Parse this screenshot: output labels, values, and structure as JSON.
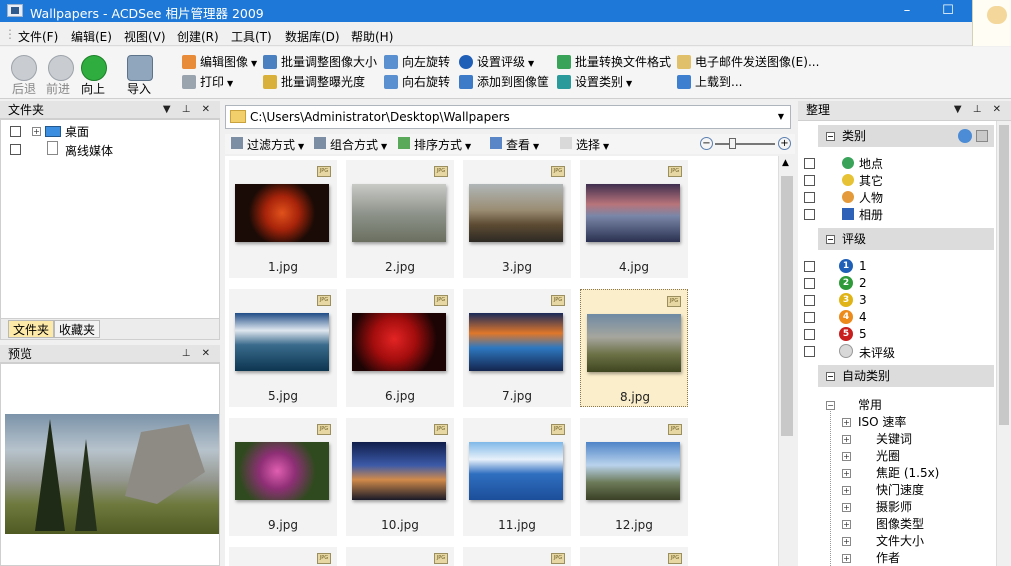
{
  "window": {
    "title": "Wallpapers - ACDSee 相片管理器 2009",
    "minimize": "–",
    "maximize": "☐"
  },
  "menu": [
    "文件(F)",
    "编辑(E)",
    "视图(V)",
    "创建(R)",
    "工具(T)",
    "数据库(D)",
    "帮助(H)"
  ],
  "toolbar": {
    "back": "后退",
    "forward": "前进",
    "up": "向上",
    "import": "导入",
    "edit_image": "编辑图像",
    "print": "打印",
    "batch_resize": "批量调整图像大小",
    "batch_exposure": "批量调整曝光度",
    "rotate_left": "向左旋转",
    "rotate_right": "向右旋转",
    "set_rating": "设置评级",
    "add_to_basket": "添加到图像筐",
    "batch_convert": "批量转换文件格式",
    "set_category": "设置类别",
    "email_images": "电子邮件发送图像(E)...",
    "upload": "上载到..."
  },
  "folders_panel": {
    "title": "文件夹",
    "items": [
      {
        "label": "桌面"
      },
      {
        "label": "离线媒体"
      }
    ],
    "tabs": [
      "文件夹",
      "收藏夹"
    ]
  },
  "preview_panel": {
    "title": "预览"
  },
  "address": {
    "path": "C:\\Users\\Administrator\\Desktop\\Wallpapers"
  },
  "view_toolbar": {
    "filter": "过滤方式",
    "group": "组合方式",
    "sort": "排序方式",
    "view": "查看",
    "select": "选择"
  },
  "files": [
    {
      "name": "1.jpg"
    },
    {
      "name": "2.jpg"
    },
    {
      "name": "3.jpg"
    },
    {
      "name": "4.jpg"
    },
    {
      "name": "5.jpg"
    },
    {
      "name": "6.jpg"
    },
    {
      "name": "7.jpg"
    },
    {
      "name": "8.jpg",
      "selected": true
    },
    {
      "name": "9.jpg"
    },
    {
      "name": "10.jpg"
    },
    {
      "name": "11.jpg"
    },
    {
      "name": "12.jpg"
    }
  ],
  "file_badge": "JPG",
  "organize_panel": {
    "title": "整理",
    "category_title": "类别",
    "categories": [
      "地点",
      "其它",
      "人物",
      "相册"
    ],
    "rating_title": "评级",
    "ratings": [
      "1",
      "2",
      "3",
      "4",
      "5",
      "未评级"
    ],
    "auto_title": "自动类别",
    "auto_root": "常用",
    "auto_items": [
      "ISO 速率",
      "关键词",
      "光圈",
      "焦距 (1.5x)",
      "快门速度",
      "摄影师",
      "图像类型",
      "文件大小",
      "作者"
    ]
  }
}
